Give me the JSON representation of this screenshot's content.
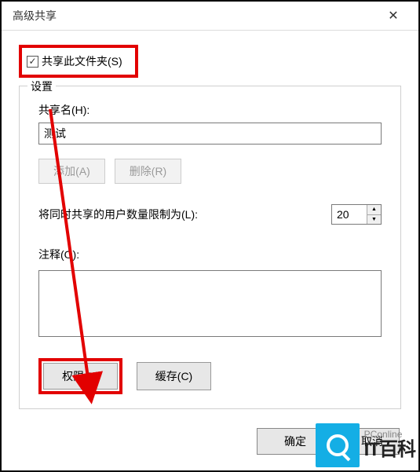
{
  "dialog": {
    "title": "高级共享",
    "close_symbol": "✕"
  },
  "share": {
    "checkbox_label": "共享此文件夹(S)"
  },
  "settings": {
    "group_label": "设置",
    "share_name_label": "共享名(H):",
    "share_name_value": "测试",
    "add_button": "添加(A)",
    "remove_button": "删除(R)",
    "limit_label": "将同时共享的用户数量限制为(L):",
    "limit_value": "20",
    "comment_label": "注释(O):",
    "comment_value": "",
    "permission_button": "权限(P)",
    "cache_button": "缓存(C)"
  },
  "actions": {
    "ok": "确定",
    "cancel": "取消"
  },
  "watermark": {
    "top": "PConline",
    "main": "IT百科"
  }
}
